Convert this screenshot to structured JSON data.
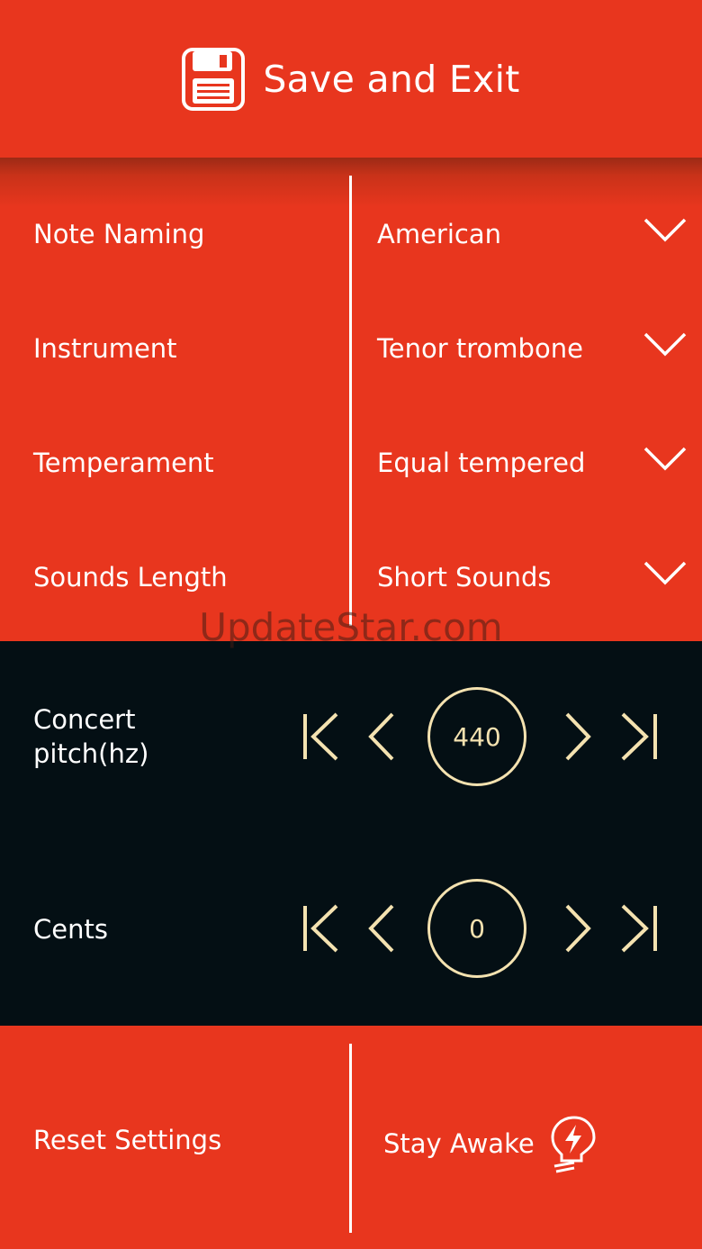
{
  "header": {
    "save_label": "Save and Exit",
    "icon": "floppy-disk-icon"
  },
  "settings": {
    "rows": [
      {
        "label": "Note Naming",
        "value": "American"
      },
      {
        "label": "Instrument",
        "value": "Tenor trombone"
      },
      {
        "label": "Temperament",
        "value": "Equal tempered"
      },
      {
        "label": "Sounds Length",
        "value": "Short Sounds"
      }
    ]
  },
  "watermark": "UpdateStar.com",
  "tuning": {
    "concert_pitch": {
      "label": "Concert\npitch(hz)",
      "value": "440"
    },
    "cents": {
      "label": "Cents",
      "value": "0"
    }
  },
  "bottom": {
    "reset_label": "Reset Settings",
    "stay_awake_label": "Stay Awake",
    "stay_awake_icon": "lightbulb-bolt-icon"
  },
  "colors": {
    "primary": "#e8361e",
    "dark_panel": "#040f14",
    "accent": "#f4e2b0",
    "text": "#ffffff"
  }
}
